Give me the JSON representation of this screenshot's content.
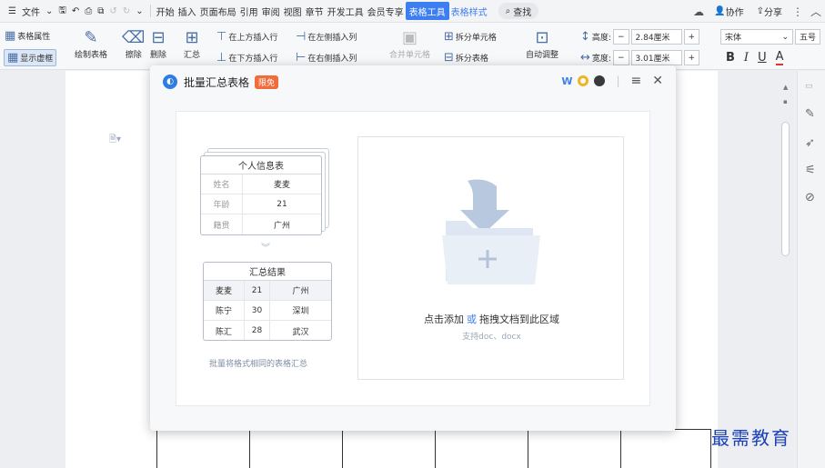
{
  "menubar": {
    "file": "文件",
    "tabs": [
      "开始",
      "插入",
      "页面布局",
      "引用",
      "审阅",
      "视图",
      "章节",
      "开发工具",
      "会员专享",
      "表格工具",
      "表格样式"
    ],
    "active_tab": "表格工具",
    "search": "查找",
    "collab": "协作",
    "share": "分享"
  },
  "ribbon": {
    "table_props": "表格属性",
    "show_gridlines": "显示虚框",
    "draw_table": "绘制表格",
    "erase": "擦除",
    "delete": "删除",
    "summary": "汇总",
    "insert_above": "在上方插入行",
    "insert_left": "在左侧插入列",
    "insert_below": "在下方插入行",
    "insert_right": "在右侧插入列",
    "merge_cells": "合并单元格",
    "split_cells": "拆分单元格",
    "split_table": "拆分表格",
    "autofit": "自动调整",
    "height_label": "高度:",
    "height_value": "2.84厘米",
    "width_label": "宽度:",
    "width_value": "3.01厘米",
    "font_name": "宋体",
    "font_size": "五号",
    "bold": "B",
    "italic": "I",
    "underline": "U",
    "font_color": "A"
  },
  "dialog": {
    "title": "批量汇总表格",
    "badge": "限免",
    "source_table": {
      "title": "个人信息表",
      "rows": [
        {
          "key": "姓名",
          "value": "麦麦"
        },
        {
          "key": "年龄",
          "value": "21"
        },
        {
          "key": "籍贯",
          "value": "广州"
        }
      ]
    },
    "result_table": {
      "title": "汇总结果",
      "rows": [
        {
          "name": "麦麦",
          "age": "21",
          "place": "广州"
        },
        {
          "name": "陈宁",
          "age": "30",
          "place": "深圳"
        },
        {
          "name": "陈汇",
          "age": "28",
          "place": "武汉"
        }
      ]
    },
    "illustration_caption": "批量将格式相同的表格汇总",
    "drop_zone": {
      "action_click": "点击添加",
      "action_or": "或",
      "action_drag": "拖拽文档到此区域",
      "supported": "支持doc、docx"
    }
  },
  "watermark": "最需教育",
  "colors": {
    "accent": "#3d7ef0",
    "badge": "#f26b3a",
    "watermark": "#1a3fb8"
  }
}
